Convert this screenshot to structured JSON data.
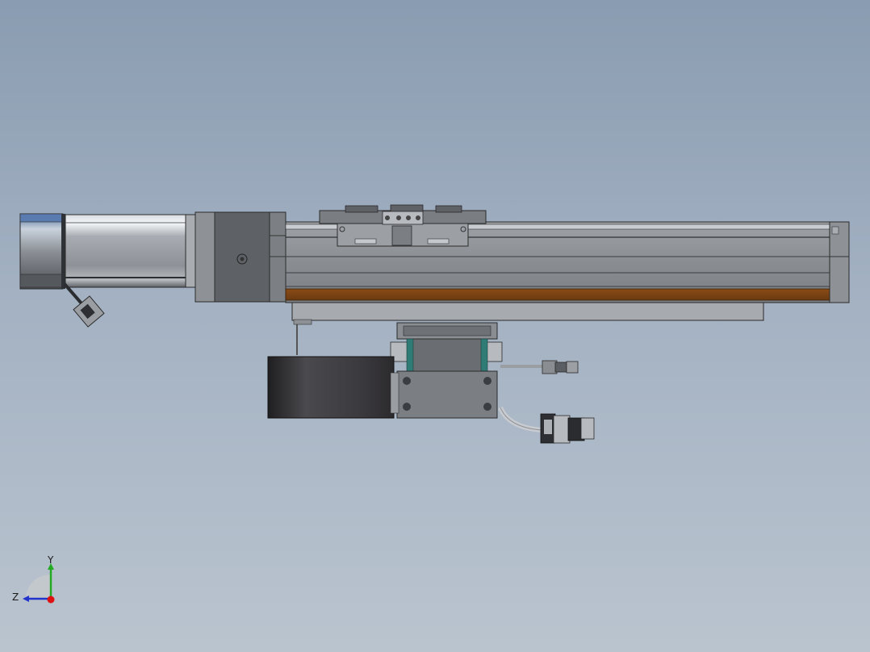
{
  "viewport": {
    "background_top": "#8a9cb1",
    "background_bottom": "#bac4cf"
  },
  "triad": {
    "y_label": "Y",
    "z_label": "Z",
    "y_color": "#22aa22",
    "z_color": "#2233cc",
    "x_color": "#dd1111"
  },
  "model": {
    "description_icon": "linear-actuator-model"
  }
}
